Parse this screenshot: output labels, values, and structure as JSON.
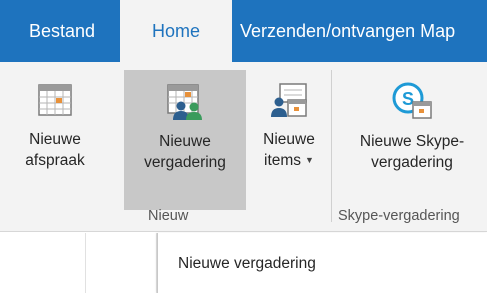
{
  "tabs": {
    "file": "Bestand",
    "home": "Home",
    "send_receive": "Verzenden/ontvangen Map"
  },
  "ribbon": {
    "new_appointment": {
      "line1": "Nieuwe",
      "line2": "afspraak",
      "icon": "calendar-icon"
    },
    "new_meeting": {
      "line1": "Nieuwe",
      "line2": "vergadering",
      "icon": "calendar-people-icon"
    },
    "new_items": {
      "line1": "Nieuwe",
      "line2": "items",
      "icon": "people-message-icon"
    },
    "new_skype_meeting": {
      "line1": "Nieuwe Skype-",
      "line2": "vergadering",
      "icon": "skype-calendar-icon"
    },
    "groups": {
      "new": "Nieuw",
      "skype": "Skype-vergadering"
    }
  },
  "dropdown": {
    "item1": "Nieuwe vergadering"
  },
  "colors": {
    "accent": "#1e73be",
    "ribbon_bg": "#f3f3f3",
    "selected": "#c8c8c8",
    "skype_blue": "#1e9ad6",
    "calendar_orange": "#e8913a"
  }
}
